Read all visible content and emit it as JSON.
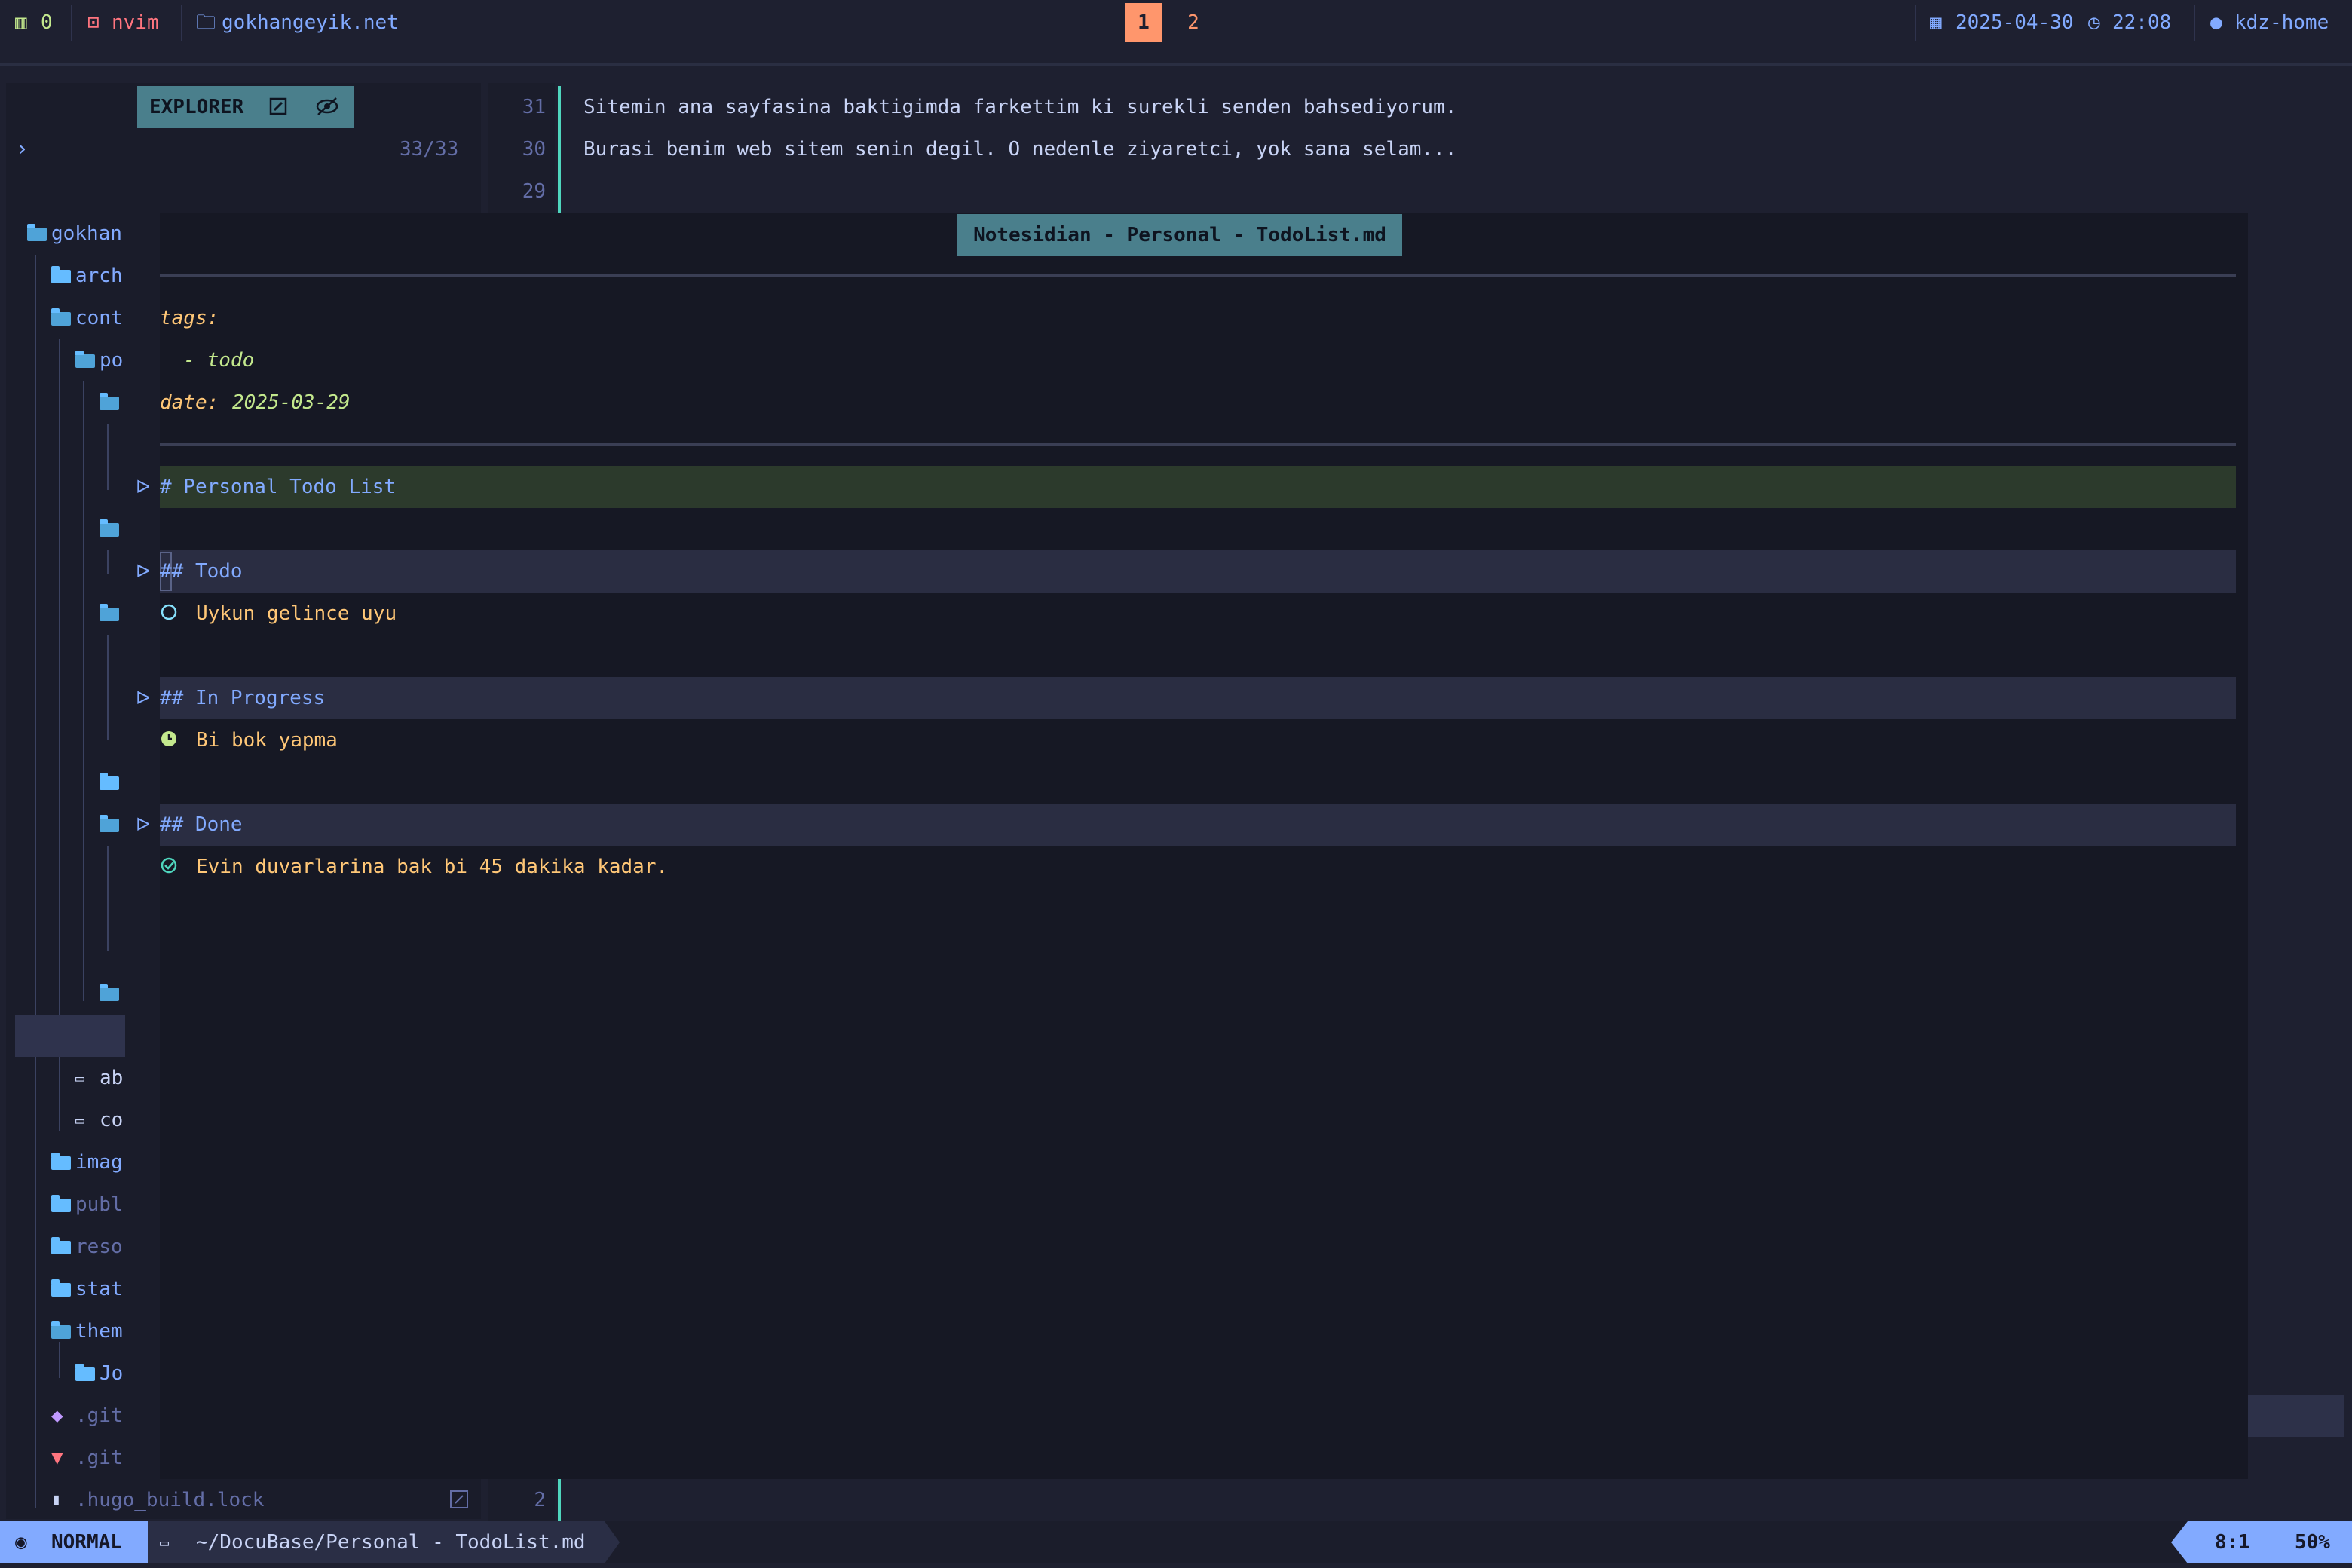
{
  "topbar": {
    "workspace_count": "0",
    "app": "nvim",
    "folder": "gokhangeyik.net",
    "tabs": [
      "1",
      "2"
    ],
    "active_tab": "1",
    "date": "2025-04-30",
    "time": "22:08",
    "host": "kdz-home"
  },
  "explorer": {
    "title": "EXPLORER",
    "count": "33/33",
    "tree": [
      {
        "label": "gokhan",
        "kind": "folder-open"
      },
      {
        "label": "arch",
        "kind": "folder"
      },
      {
        "label": "cont",
        "kind": "folder-open"
      },
      {
        "label": "po",
        "kind": "folder-open"
      },
      {
        "label": "",
        "kind": "folder-open"
      },
      {
        "label": "",
        "kind": "folder-open"
      },
      {
        "label": "",
        "kind": "folder-open"
      },
      {
        "label": "",
        "kind": "folder"
      },
      {
        "label": "",
        "kind": "folder-open"
      },
      {
        "label": "",
        "kind": "folder-open"
      },
      {
        "label": "ab",
        "kind": "markdown"
      },
      {
        "label": "co",
        "kind": "markdown"
      },
      {
        "label": "imag",
        "kind": "folder"
      },
      {
        "label": "publ",
        "kind": "folder"
      },
      {
        "label": "reso",
        "kind": "folder"
      },
      {
        "label": "stat",
        "kind": "folder"
      },
      {
        "label": "them",
        "kind": "folder-open"
      },
      {
        "label": "Jo",
        "kind": "folder"
      },
      {
        "label": ".git",
        "kind": "git"
      },
      {
        "label": ".git",
        "kind": "gitlab"
      },
      {
        "label": ".hugo_build.lock",
        "kind": "file"
      }
    ]
  },
  "editor_top": {
    "lines": [
      {
        "num": "31",
        "text": "Sitemin ana sayfasina baktigimda farkettim ki surekli senden bahsediyorum."
      },
      {
        "num": "30",
        "text": "Burasi benim web sitem senin degil. O nedenle ziyaretci, yok sana selam..."
      },
      {
        "num": "29",
        "text": ""
      }
    ]
  },
  "float": {
    "title": "Notesidian - Personal - TodoList.md",
    "frontmatter": {
      "tags_key": "tags:",
      "tag_item": "  - todo",
      "date_key": "date:",
      "date_val": "2025-03-29"
    },
    "h1": "# Personal Todo List",
    "sections": [
      {
        "heading": "## Todo",
        "item": "Uykun gelince uyu",
        "status": "todo"
      },
      {
        "heading": "## In Progress",
        "item": "Bi bok yapma",
        "status": "in-progress"
      },
      {
        "heading": "## Done",
        "item": "Evin duvarlarina bak bi 45 dakika kadar.",
        "status": "done"
      }
    ]
  },
  "editor_bottom": {
    "num": "2"
  },
  "statusbar": {
    "mode": "NORMAL",
    "file": "~/DocuBase/Personal - TodoList.md",
    "position": "8:1",
    "percent": "50%"
  },
  "colors": {
    "accent": "#82aaff",
    "tab_active": "#ff966c",
    "heading_bg": "#2a2d42",
    "h1_bg": "#2c3a2c",
    "frontmatter_key": "#ffc777",
    "frontmatter_val": "#c3e88d"
  }
}
